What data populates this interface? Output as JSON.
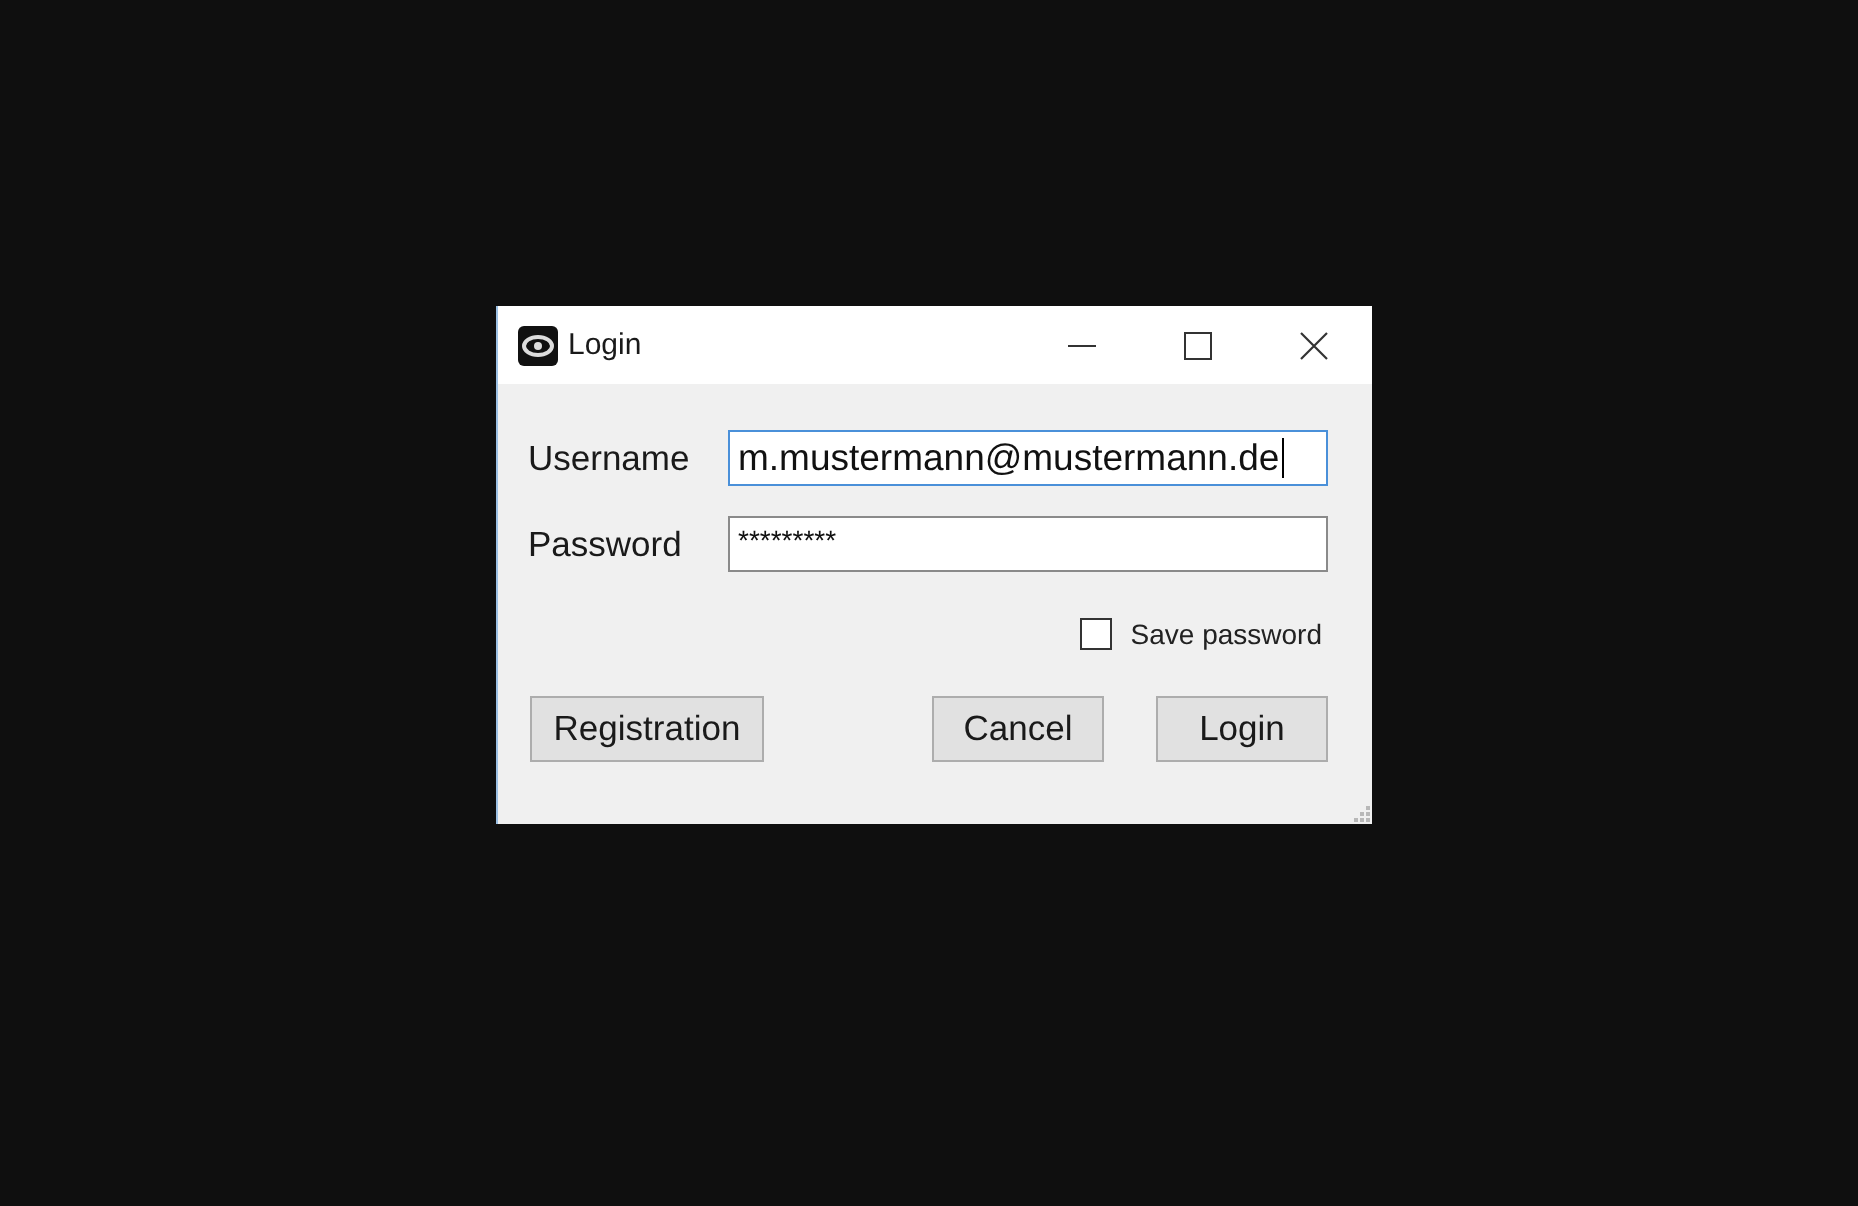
{
  "window": {
    "title": "Login"
  },
  "fields": [
    {
      "label": "Username",
      "value": "m.mustermann@mustermann.de",
      "focused": true
    },
    {
      "label": "Password",
      "value": "*********",
      "focused": false
    }
  ],
  "save_password": {
    "label": "Save password",
    "checked": false
  },
  "left_buttons": [
    "Registration"
  ],
  "right_buttons": [
    "Cancel",
    "Login"
  ]
}
